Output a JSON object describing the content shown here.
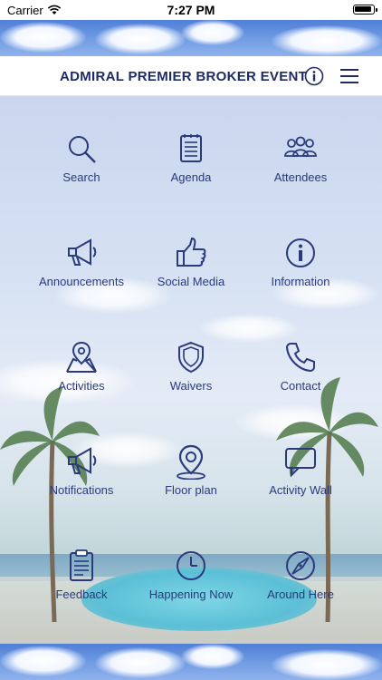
{
  "status_bar": {
    "carrier": "Carrier",
    "time": "7:27 PM"
  },
  "header": {
    "title": "ADMIRAL PREMIER BROKER EVENT"
  },
  "tiles": [
    {
      "label": "Search",
      "icon": "search-icon"
    },
    {
      "label": "Agenda",
      "icon": "agenda-icon"
    },
    {
      "label": "Attendees",
      "icon": "attendees-icon"
    },
    {
      "label": "Announcements",
      "icon": "megaphone-icon"
    },
    {
      "label": "Social Media",
      "icon": "thumbs-up-icon"
    },
    {
      "label": "Information",
      "icon": "info-icon"
    },
    {
      "label": "Activities",
      "icon": "map-pin-icon"
    },
    {
      "label": "Waivers",
      "icon": "shield-icon"
    },
    {
      "label": "Contact",
      "icon": "phone-icon"
    },
    {
      "label": "Notifications",
      "icon": "megaphone-icon"
    },
    {
      "label": "Floor plan",
      "icon": "location-pin-icon"
    },
    {
      "label": "Activity Wall",
      "icon": "chat-icon"
    },
    {
      "label": "Feedback",
      "icon": "clipboard-icon"
    },
    {
      "label": "Happening Now",
      "icon": "clock-icon"
    },
    {
      "label": "Around Here",
      "icon": "compass-icon"
    }
  ],
  "colors": {
    "accent": "#2a3a7c",
    "title": "#1f2b63"
  }
}
